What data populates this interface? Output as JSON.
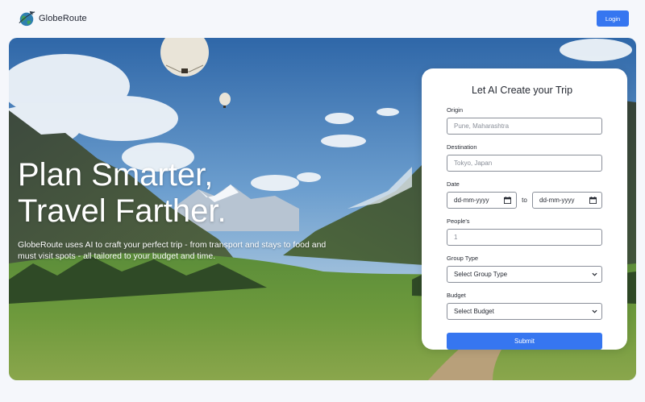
{
  "header": {
    "brand_name": "GlobeRoute",
    "login_label": "Login"
  },
  "hero": {
    "title_line1": "Plan Smarter,",
    "title_line2": "Travel Farther.",
    "subtitle_line1": "GlobeRoute uses AI to craft your perfect trip - from transport and stays to food and",
    "subtitle_line2": "must visit spots - all tailored to your budget and time."
  },
  "form": {
    "title": "Let AI Create your Trip",
    "origin": {
      "label": "Origin",
      "placeholder": "Pune, Maharashtra"
    },
    "destination": {
      "label": "Destination",
      "placeholder": "Tokyo, Japan"
    },
    "date": {
      "label": "Date",
      "from_placeholder": "dd-mm-yyyy",
      "to_text": "to",
      "to_placeholder": "dd-mm-yyyy"
    },
    "people": {
      "label": "People's",
      "value": "1"
    },
    "group_type": {
      "label": "Group Type",
      "selected": "Select Group Type"
    },
    "budget": {
      "label": "Budget",
      "selected": "Select Budget"
    },
    "submit_label": "Submit"
  },
  "colors": {
    "accent": "#3676f0",
    "background": "#f5f7fb"
  },
  "icons": [
    "globe-plane-logo-icon",
    "calendar-icon",
    "chevron-down-icon"
  ]
}
